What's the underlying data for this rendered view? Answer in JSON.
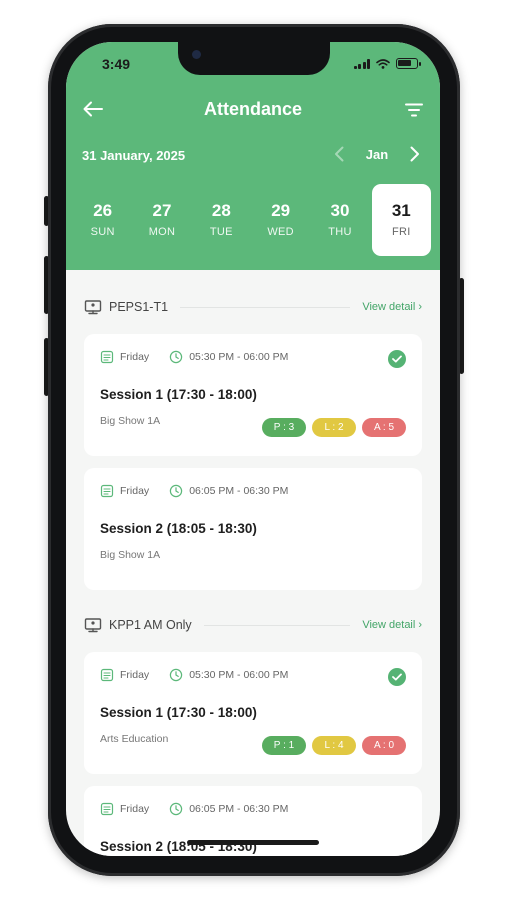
{
  "status_bar": {
    "time": "3:49"
  },
  "header": {
    "title": "Attendance",
    "date": "31 January, 2025",
    "month": "Jan",
    "days": [
      {
        "num": "26",
        "dow": "SUN"
      },
      {
        "num": "27",
        "dow": "MON"
      },
      {
        "num": "28",
        "dow": "TUE"
      },
      {
        "num": "29",
        "dow": "WED"
      },
      {
        "num": "30",
        "dow": "THU"
      },
      {
        "num": "31",
        "dow": "FRI"
      }
    ]
  },
  "groups": [
    {
      "name": "PEPS1-T1",
      "view_detail": "View detail",
      "sessions": [
        {
          "day": "Friday",
          "time": "05:30 PM - 06:00 PM",
          "title": "Session 1 (17:30 - 18:00)",
          "subject": "Big Show 1A",
          "present": "P : 3",
          "late": "L : 2",
          "absent": "A : 5",
          "completed": true
        },
        {
          "day": "Friday",
          "time": "06:05 PM - 06:30 PM",
          "title": "Session 2 (18:05 - 18:30)",
          "subject": "Big Show 1A",
          "completed": false
        }
      ]
    },
    {
      "name": "KPP1 AM Only",
      "view_detail": "View detail",
      "sessions": [
        {
          "day": "Friday",
          "time": "05:30 PM - 06:00 PM",
          "title": "Session 1 (17:30 - 18:00)",
          "subject": "Arts Education",
          "present": "P : 1",
          "late": "L : 4",
          "absent": "A : 0",
          "completed": true
        },
        {
          "day": "Friday",
          "time": "06:05 PM - 06:30 PM",
          "title": "Session 2 (18:05 - 18:30)",
          "completed": false
        }
      ]
    }
  ],
  "colors": {
    "header": "#5cb87a",
    "present": "#58ad5f",
    "late": "#e1c842",
    "absent": "#e57272",
    "link": "#43a568"
  }
}
